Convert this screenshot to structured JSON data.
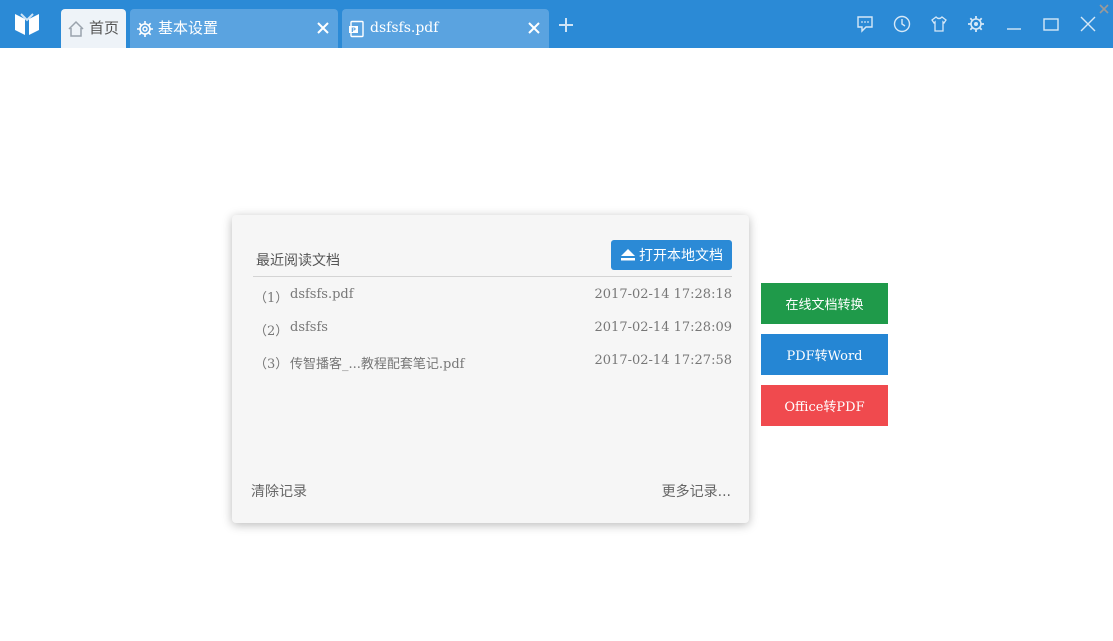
{
  "tabs": [
    {
      "label": "首页",
      "icon": "home-icon"
    },
    {
      "label": "基本设置",
      "icon": "gear-icon"
    },
    {
      "label": "dsfsfs.pdf",
      "icon": "pdf-file-icon"
    }
  ],
  "window_controls": [
    "feedback-icon",
    "history-icon",
    "skin-icon",
    "settings-icon",
    "minimize-icon",
    "maximize-icon",
    "close-icon"
  ],
  "recent": {
    "title": "最近阅读文档",
    "open_button": "打开本地文档",
    "items": [
      {
        "index": "（1）",
        "name": "dsfsfs.pdf",
        "time": "2017-02-14 17:28:18"
      },
      {
        "index": "（2）",
        "name": "dsfsfs",
        "time": "2017-02-14 17:28:09"
      },
      {
        "index": "（3）",
        "name": "传智播客_...教程配套笔记.pdf",
        "time": "2017-02-14 17:27:58"
      }
    ],
    "clear_label": "清除记录",
    "more_label": "更多记录..."
  },
  "actions": [
    {
      "label": "在线文档转换",
      "color": "#1f9a4a"
    },
    {
      "label": "PDF转Word",
      "color": "#2586d4"
    },
    {
      "label": "Office转PDF",
      "color": "#f04a4e"
    }
  ]
}
